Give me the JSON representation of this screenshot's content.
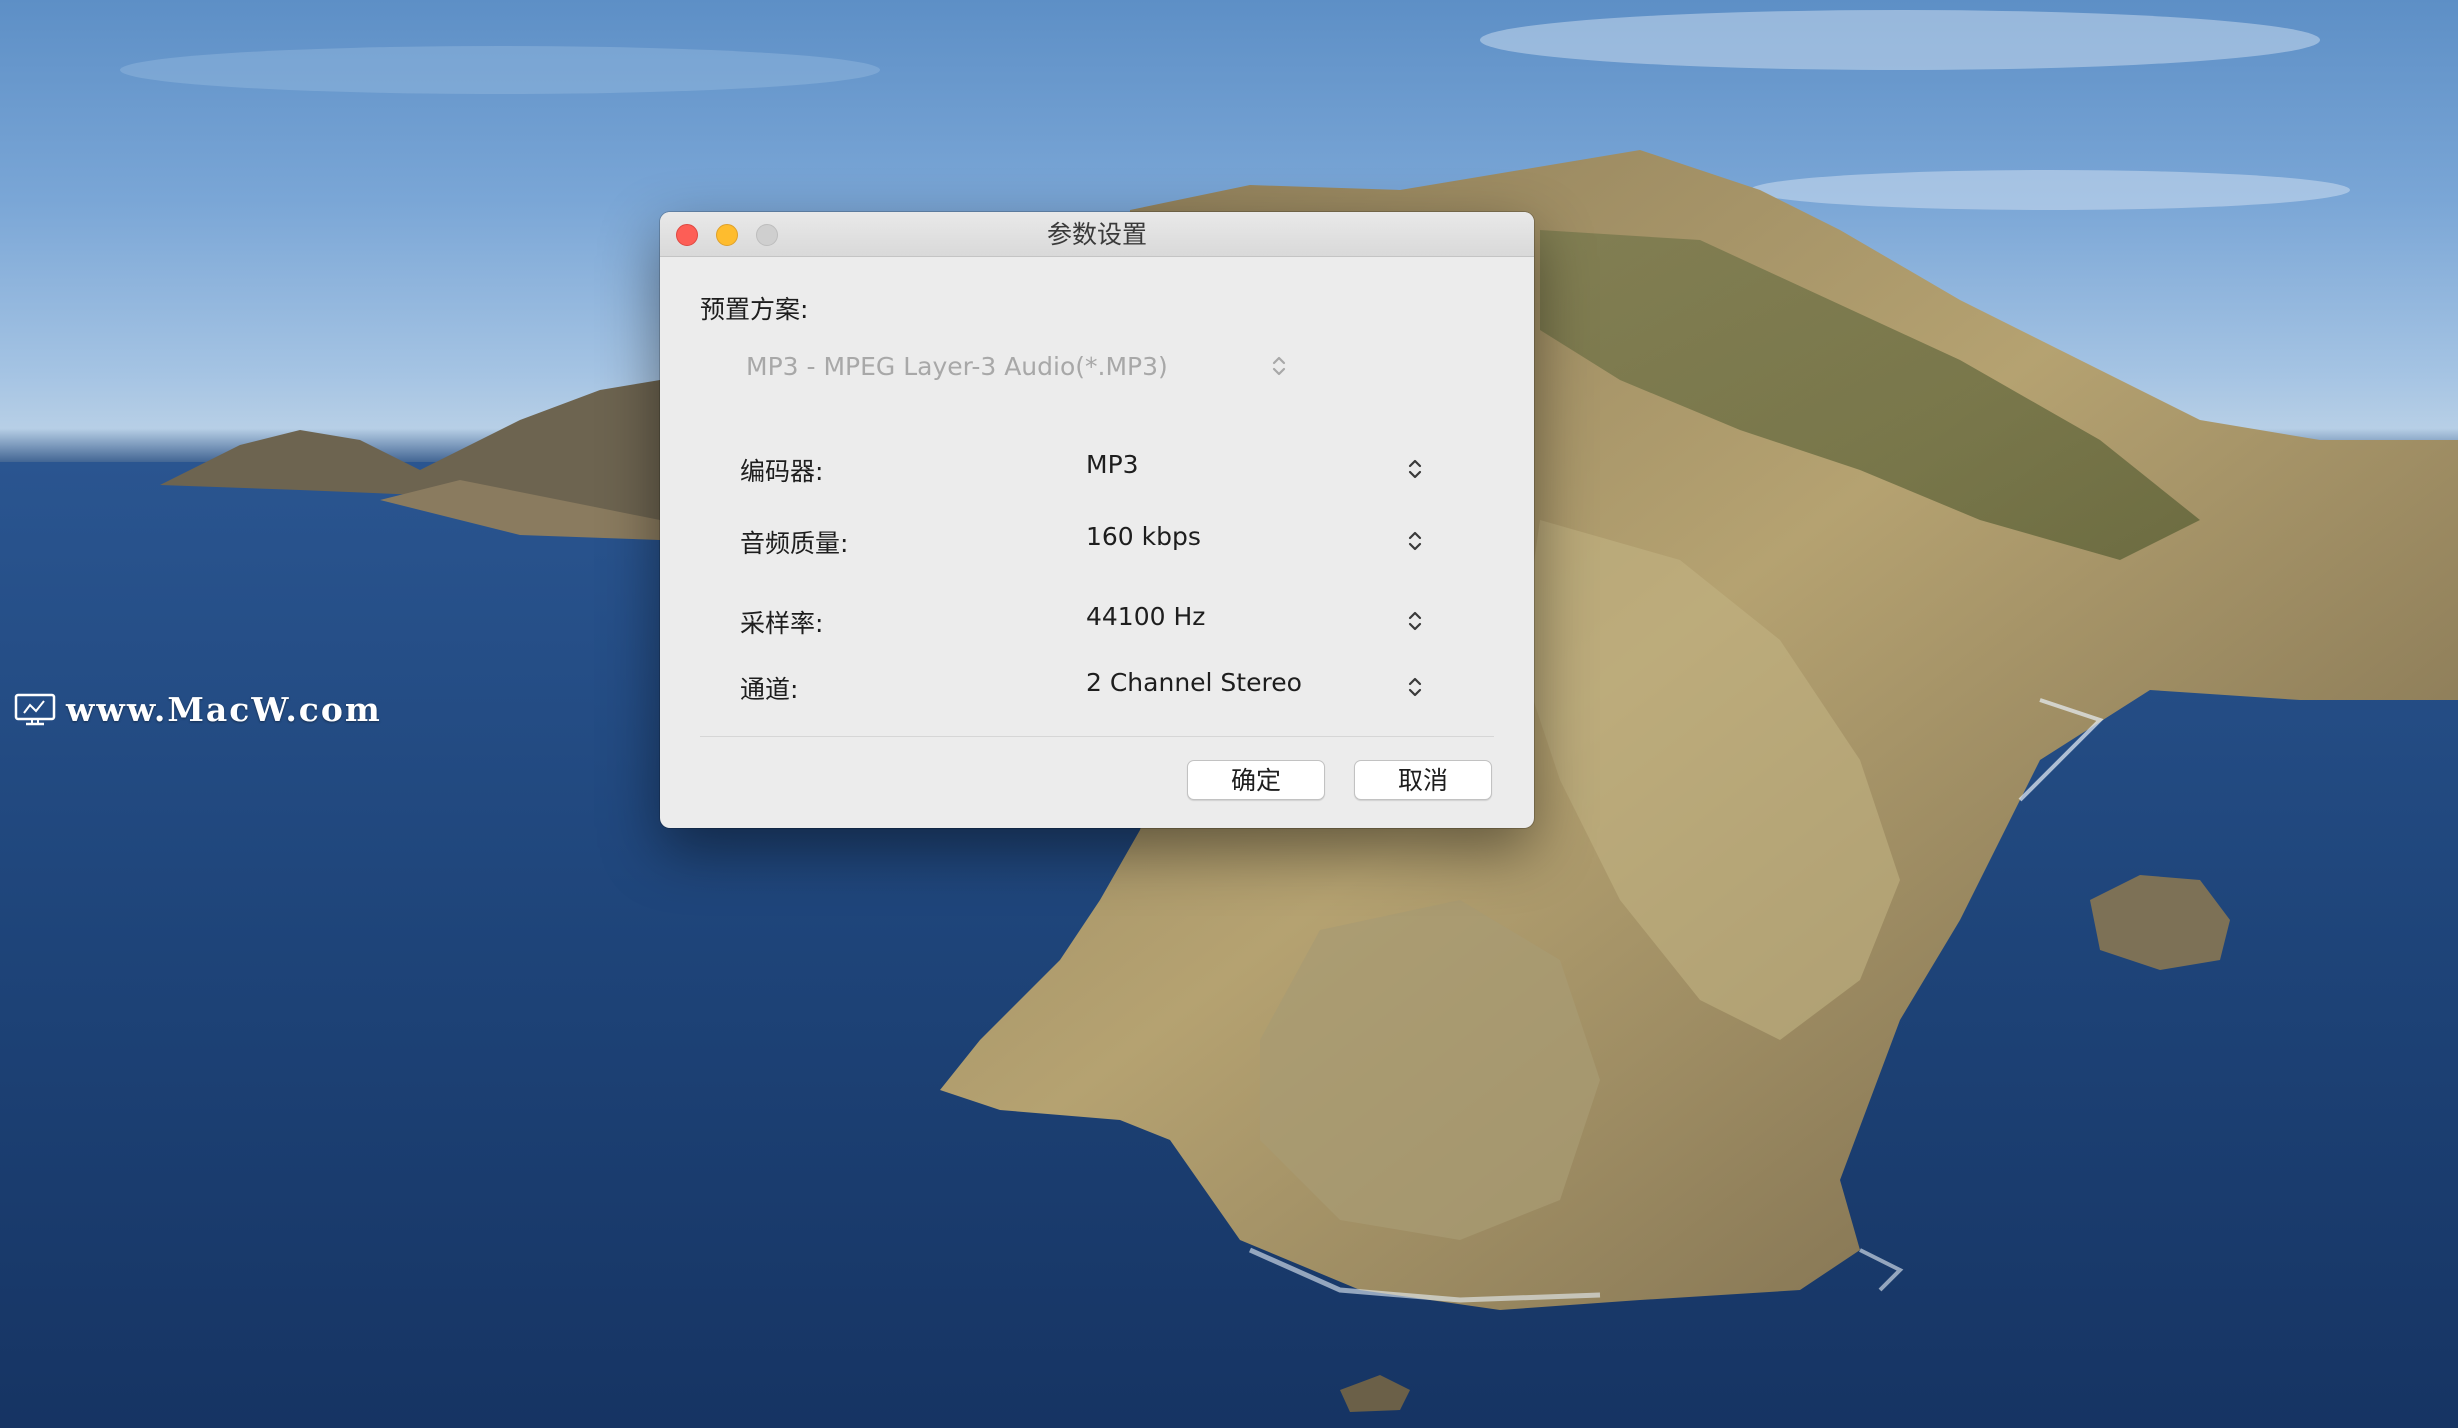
{
  "desktop": {
    "watermark_text": "www.MacW.com",
    "watermark_icon": "monitor-icon"
  },
  "window": {
    "title": "参数设置",
    "controls": [
      "close-icon",
      "minimize-icon",
      "zoom-icon"
    ]
  },
  "preset": {
    "label": "预置方案:",
    "value": "MP3 - MPEG Layer-3 Audio(*.MP3)",
    "icon": "stepper-icon"
  },
  "settings": [
    {
      "label": "编码器:",
      "value": "MP3"
    },
    {
      "label": "音频质量:",
      "value": "160 kbps"
    },
    {
      "label": "采样率:",
      "value": "44100 Hz"
    },
    {
      "label": "通道:",
      "value": "2 Channel Stereo"
    }
  ],
  "buttons": {
    "ok_label": "确定",
    "cancel_label": "取消"
  },
  "colors": {
    "close": "#fd5e56",
    "minimize": "#febc2e",
    "zoom": "#cfcfcf",
    "window_background": "#ececec",
    "disabled_text": "#a8a8a8"
  }
}
